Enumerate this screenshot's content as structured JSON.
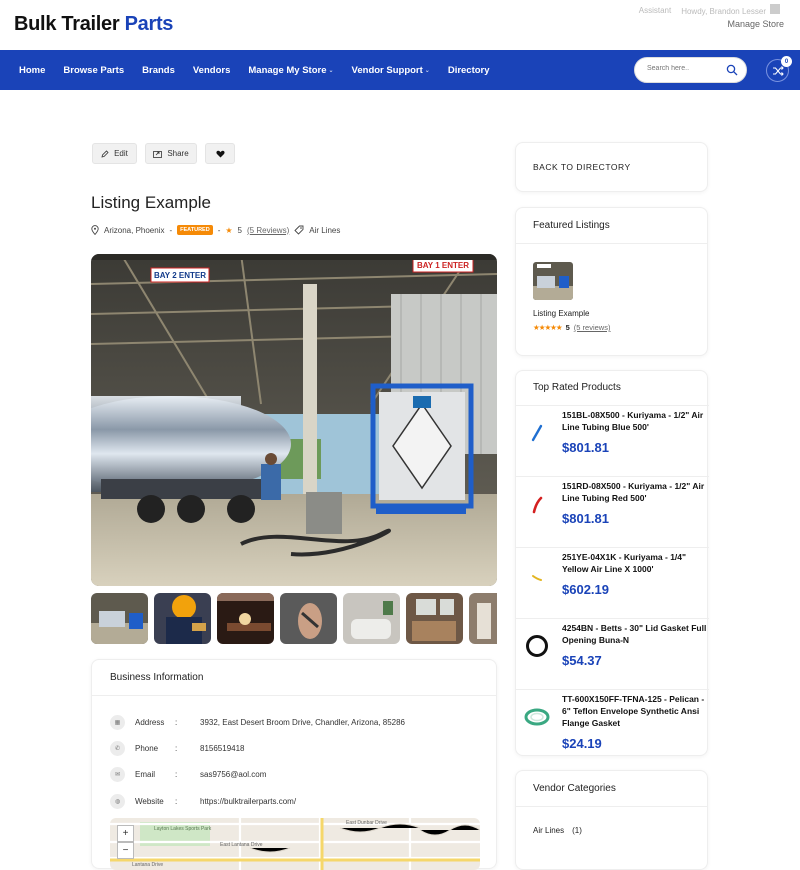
{
  "brand": {
    "name_part1": "Bulk Trailer ",
    "name_part2": "Parts"
  },
  "top_links": {
    "assistant": "Assistant",
    "howdy": "Howdy, Brandon Lesser",
    "manage_store": "Manage Store"
  },
  "nav": {
    "items": [
      {
        "label": "Home",
        "dropdown": false
      },
      {
        "label": "Browse Parts",
        "dropdown": false
      },
      {
        "label": "Brands",
        "dropdown": false
      },
      {
        "label": "Vendors",
        "dropdown": false
      },
      {
        "label": "Manage My Store",
        "dropdown": true
      },
      {
        "label": "Vendor Support",
        "dropdown": true
      },
      {
        "label": "Directory",
        "dropdown": false
      }
    ],
    "search_placeholder": "Search here..",
    "compare_count": "0"
  },
  "actions": {
    "edit": "Edit",
    "share": "Share"
  },
  "listing": {
    "title": "Listing Example",
    "location": "Arizona, Phoenix",
    "featured": "FEATURED",
    "rating": "5",
    "reviews": "(5 Reviews)",
    "category": "Air Lines",
    "signs": {
      "bay2": "BAY 2 ENTER",
      "bay1": "BAY 1 ENTER"
    }
  },
  "business": {
    "heading": "Business Information",
    "rows": [
      {
        "label": "Address",
        "value": "3932, East Desert Broom Drive, Chandler, Arizona, 85286",
        "icon": "map-icon"
      },
      {
        "label": "Phone",
        "value": "8156519418",
        "icon": "phone-icon"
      },
      {
        "label": "Email",
        "value": "sas9756@aol.com",
        "icon": "mail-icon"
      },
      {
        "label": "Website",
        "value": "https://bulktrailerparts.com/",
        "icon": "globe-icon"
      }
    ],
    "map_labels": {
      "lantana": "East Lantana Drive",
      "dunbar": "East Dunbar Drive",
      "lantana2": "Lantana Drive",
      "park": "Layton Lakes Sports Park"
    }
  },
  "sidebar": {
    "back": "BACK TO DIRECTORY",
    "featured": {
      "heading": "Featured Listings",
      "item_title": "Listing Example",
      "rating": "5",
      "reviews": "(5 reviews)"
    },
    "top_rated": {
      "heading": "Top Rated Products",
      "products": [
        {
          "name": "151BL-08X500 - Kuriyama - 1/2\" Air Line Tubing Blue 500'",
          "price": "$801.81",
          "color": "#1f6fd1"
        },
        {
          "name": "151RD-08X500 - Kuriyama - 1/2\" Air Line Tubing Red 500'",
          "price": "$801.81",
          "color": "#d42020"
        },
        {
          "name": "251YE-04X1K - Kuriyama - 1/4\" Yellow Air Line X 1000'",
          "price": "$602.19",
          "color": "#e3b520"
        },
        {
          "name": "4254BN - Betts - 30\" Lid Gasket Full Opening Buna-N",
          "price": "$54.37",
          "color": "#111111"
        },
        {
          "name": "TT-600X150FF-TFNA-125 - Pelican - 6\" Teflon Envelope Synthetic Ansi Flange Gasket",
          "price": "$24.19",
          "color": "#3aa882"
        }
      ]
    },
    "vendor_categories": {
      "heading": "Vendor Categories",
      "item": "Air Lines",
      "count": "(1)"
    }
  }
}
